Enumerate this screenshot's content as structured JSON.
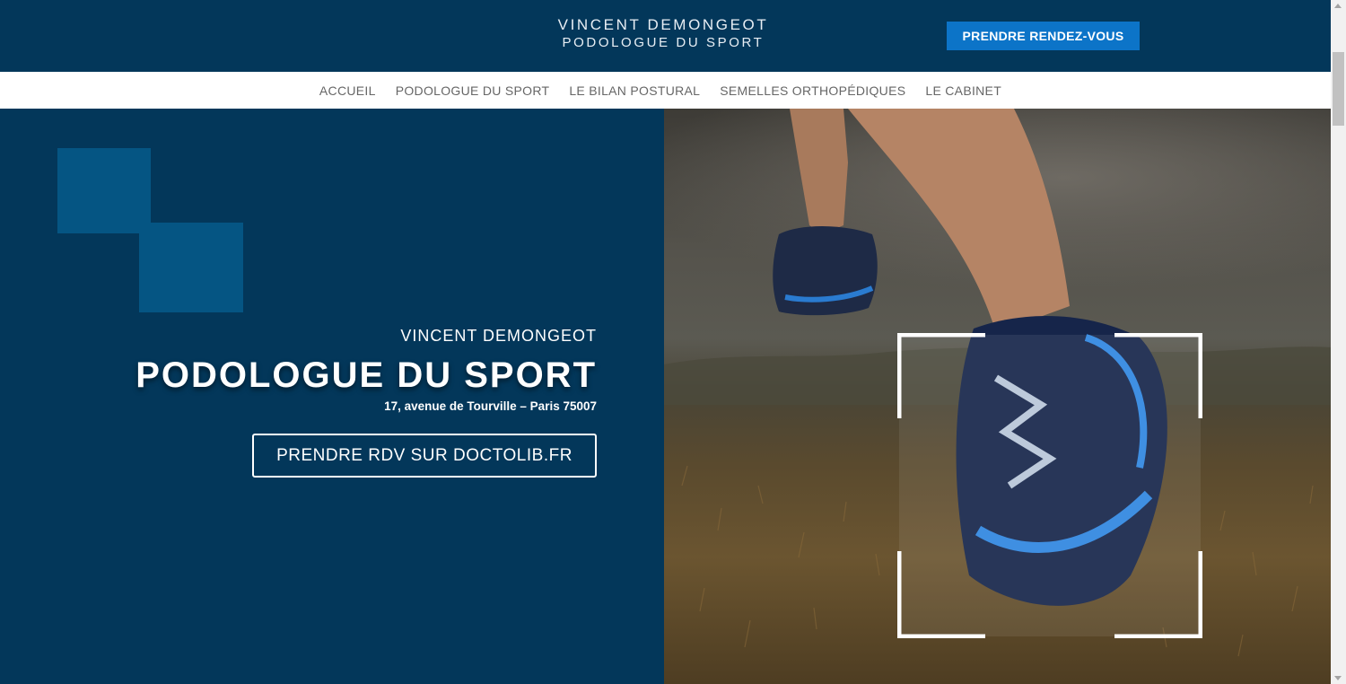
{
  "header": {
    "brand_name": "VINCENT DEMONGEOT",
    "brand_subtitle": "PODOLOGUE DU SPORT",
    "cta_label": "PRENDRE RENDEZ-VOUS"
  },
  "nav": {
    "items": [
      {
        "label": "ACCUEIL"
      },
      {
        "label": "PODOLOGUE DU SPORT"
      },
      {
        "label": "LE BILAN POSTURAL"
      },
      {
        "label": "SEMELLES ORTHOPÉDIQUES"
      },
      {
        "label": "LE CABINET"
      }
    ]
  },
  "hero": {
    "name": "VINCENT DEMONGEOT",
    "title": "PODOLOGUE DU SPORT",
    "address": "17, avenue de Tourville – Paris 75007",
    "button_label": "PRENDRE RDV SUR DOCTOLIB.FR",
    "image": "running-shoe-photo"
  },
  "colors": {
    "header_bg": "#03375a",
    "accent_button": "#0c74c8",
    "decor_square": "#055583",
    "nav_text": "#666666"
  }
}
